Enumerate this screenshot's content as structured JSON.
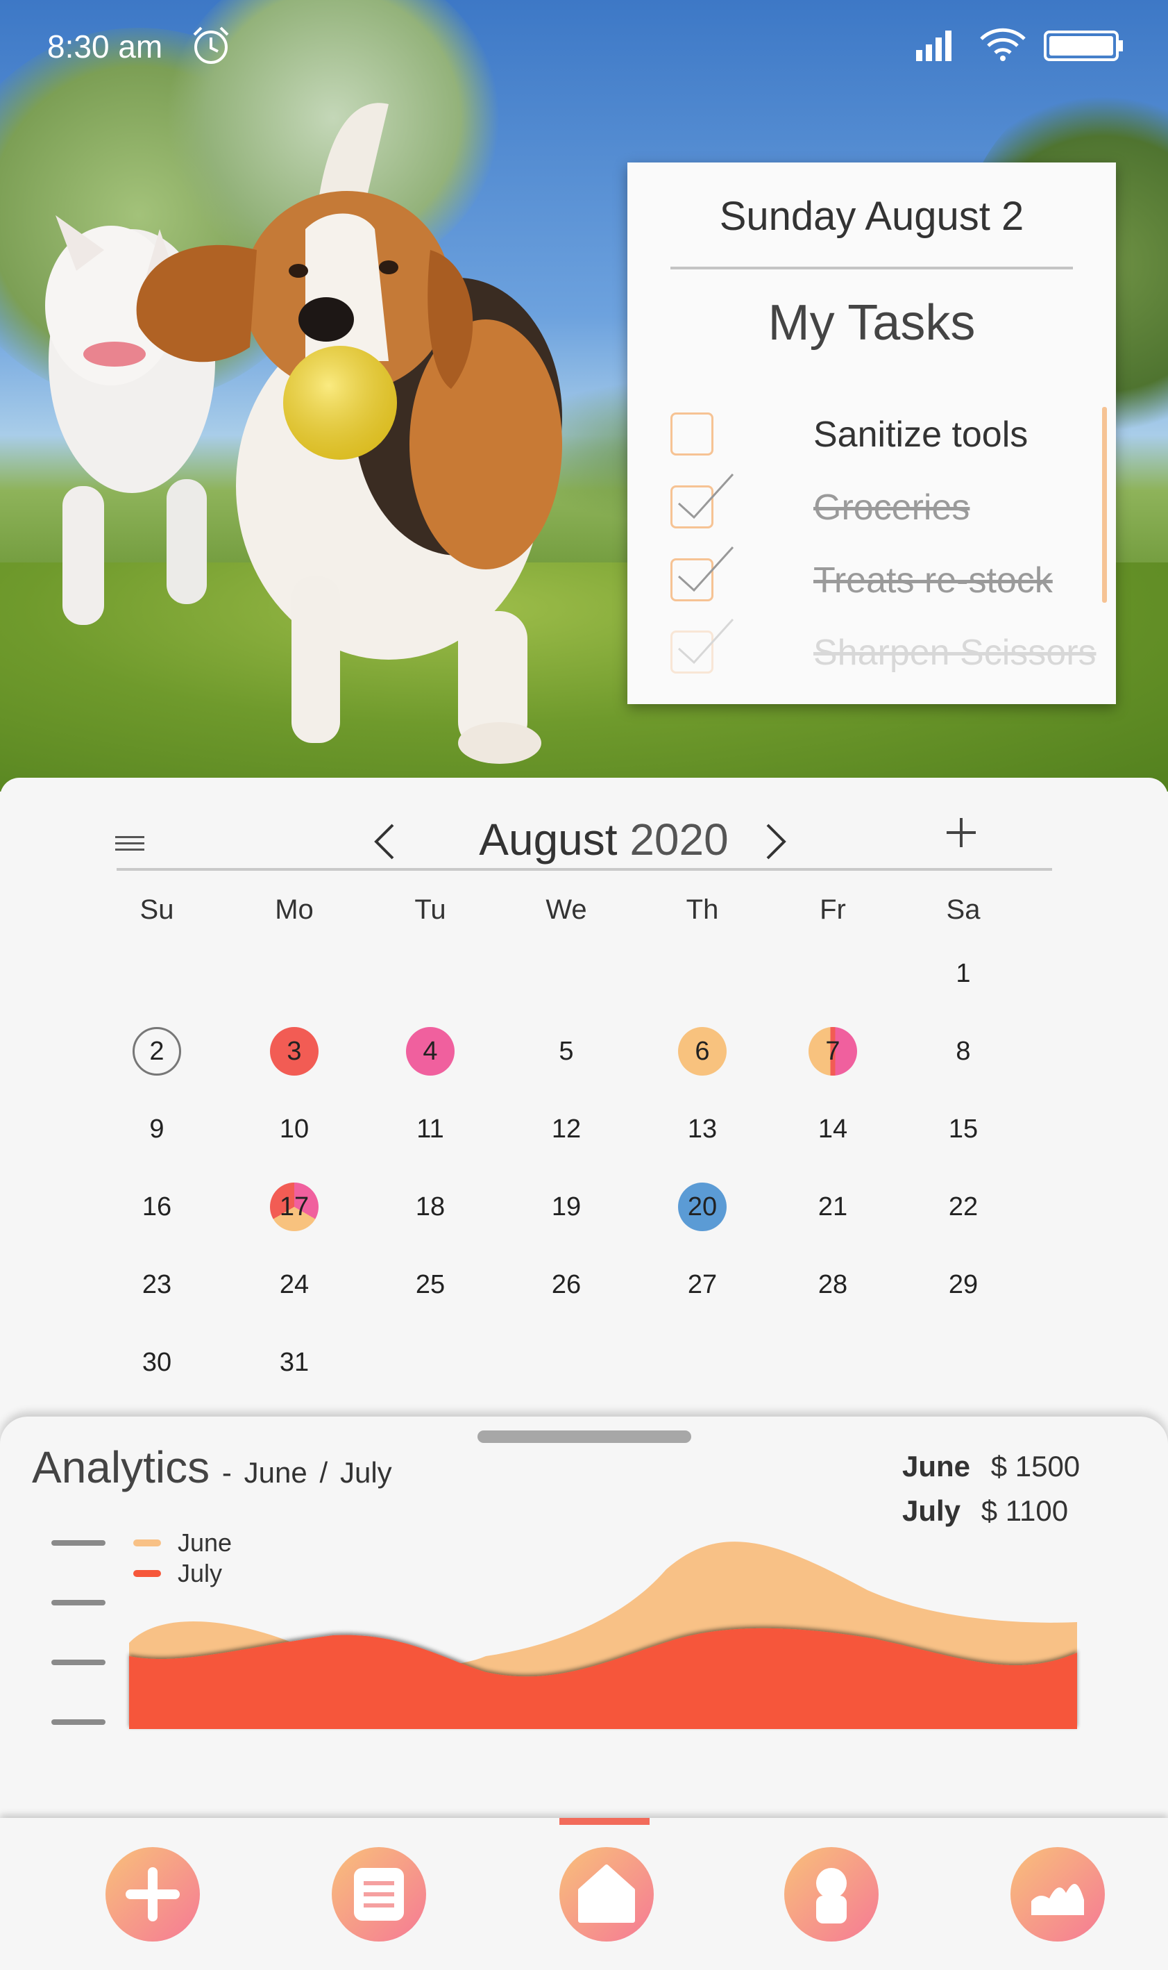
{
  "status": {
    "time": "8:30 am"
  },
  "card": {
    "date": "Sunday August 2",
    "title": "My Tasks",
    "tasks": [
      {
        "label": "Sanitize tools",
        "done": false
      },
      {
        "label": "Groceries",
        "done": true
      },
      {
        "label": "Treats re-stock",
        "done": true
      },
      {
        "label": "Sharpen Scissors",
        "done": true
      }
    ]
  },
  "calendar": {
    "month": "August",
    "year": "2020",
    "weekdays": [
      "Su",
      "Mo",
      "Tu",
      "We",
      "Th",
      "Fr",
      "Sa"
    ],
    "days": [
      "1",
      "2",
      "3",
      "4",
      "5",
      "6",
      "7",
      "8",
      "9",
      "10",
      "11",
      "12",
      "13",
      "14",
      "15",
      "16",
      "17",
      "18",
      "19",
      "20",
      "21",
      "22",
      "23",
      "24",
      "25",
      "26",
      "27",
      "28",
      "29",
      "30",
      "31"
    ],
    "colors": {
      "red": "#f25c54",
      "pink": "#f0609e",
      "peach": "#f8c27e",
      "blue": "#5b9bd5"
    }
  },
  "analytics": {
    "title": "Analytics",
    "dash": "-",
    "period_a": "June",
    "slash": "/",
    "period_b": "July",
    "legend": [
      "June",
      "July"
    ],
    "totals": [
      {
        "label": "June",
        "value": "$ 1500"
      },
      {
        "label": "July",
        "value": "$ 1100"
      }
    ],
    "colors": {
      "june": "#f8c186",
      "july": "#f6573a"
    }
  },
  "nav": {
    "items": [
      "add-icon",
      "list-icon",
      "home-icon",
      "profile-icon",
      "chart-icon"
    ],
    "active": "home-icon"
  }
}
